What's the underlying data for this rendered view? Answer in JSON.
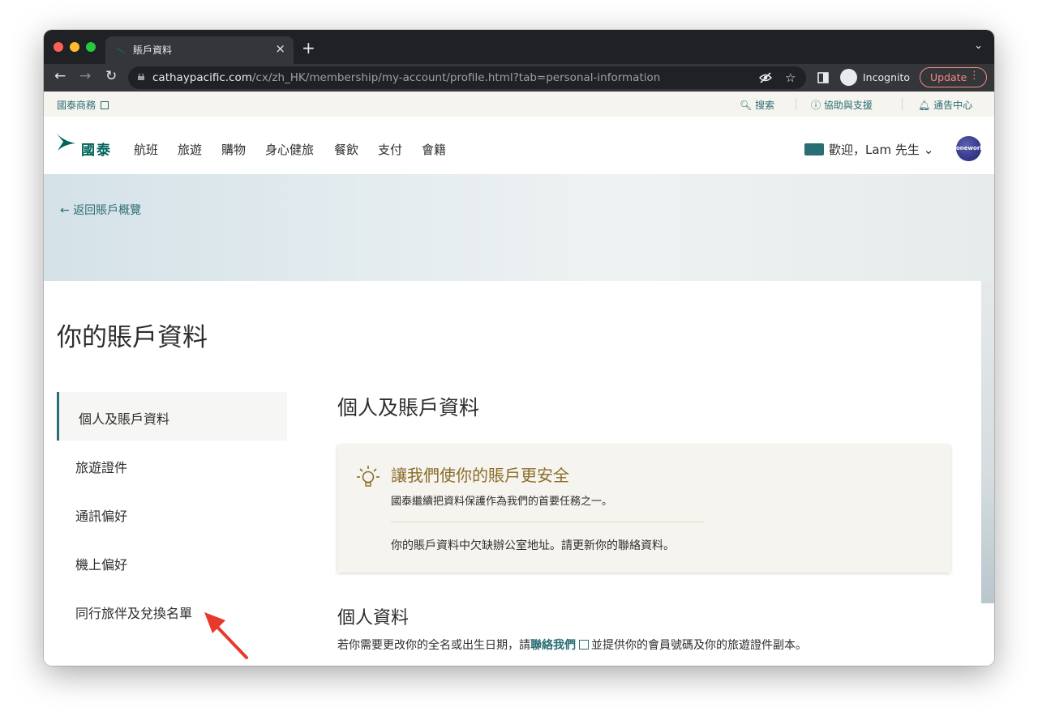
{
  "browser": {
    "tab_title": "賬戶資料",
    "tab_close": "×",
    "new_tab": "+",
    "tab_menu": "⌄",
    "back": "←",
    "forward": "→",
    "reload": "↻",
    "url_host": "cathaypacific.com",
    "url_path": "/cx/zh_HK/membership/my-account/profile.html?tab=personal-information",
    "incognito_label": "Incognito",
    "update_label": "Update",
    "icons": [
      "eye-off-icon",
      "star-icon",
      "sidebar-icon",
      "incognito-icon",
      "more-icon"
    ]
  },
  "utility_bar": {
    "business": "國泰商務",
    "search": "搜索",
    "help": "協助與支援",
    "notifications": "通告中心"
  },
  "header": {
    "logo_text": "國泰",
    "nav": [
      "航班",
      "旅遊",
      "購物",
      "身心健旅",
      "餐飲",
      "支付",
      "會籍"
    ],
    "welcome": "歡迎，Lam 先生",
    "oneworld": "oneworld"
  },
  "hero": {
    "back_link": "返回賬戶概覽"
  },
  "main": {
    "page_title": "你的賬戶資料",
    "sidebar": [
      {
        "label": "個人及賬戶資料",
        "active": true
      },
      {
        "label": "旅遊證件",
        "active": false
      },
      {
        "label": "通訊偏好",
        "active": false
      },
      {
        "label": "機上偏好",
        "active": false
      },
      {
        "label": "同行旅伴及兌換名單",
        "active": false
      }
    ],
    "section_title": "個人及賬戶資料",
    "alert": {
      "title": "讓我們使你的賬戶更安全",
      "desc": "國泰繼續把資料保護作為我們的首要任務之一。",
      "message": "你的賬戶資料中欠缺辦公室地址。請更新你的聯絡資料。"
    },
    "personal": {
      "title": "個人資料",
      "text_before": "若你需要更改你的全名或出生日期，請",
      "link": "聯絡我們",
      "text_after": "並提供你的會員號碼及你的旅遊證件副本。"
    }
  },
  "colors": {
    "brand_teal": "#2a6d73",
    "gold": "#8a6d2b",
    "annotation_arrow": "#e8392c"
  }
}
